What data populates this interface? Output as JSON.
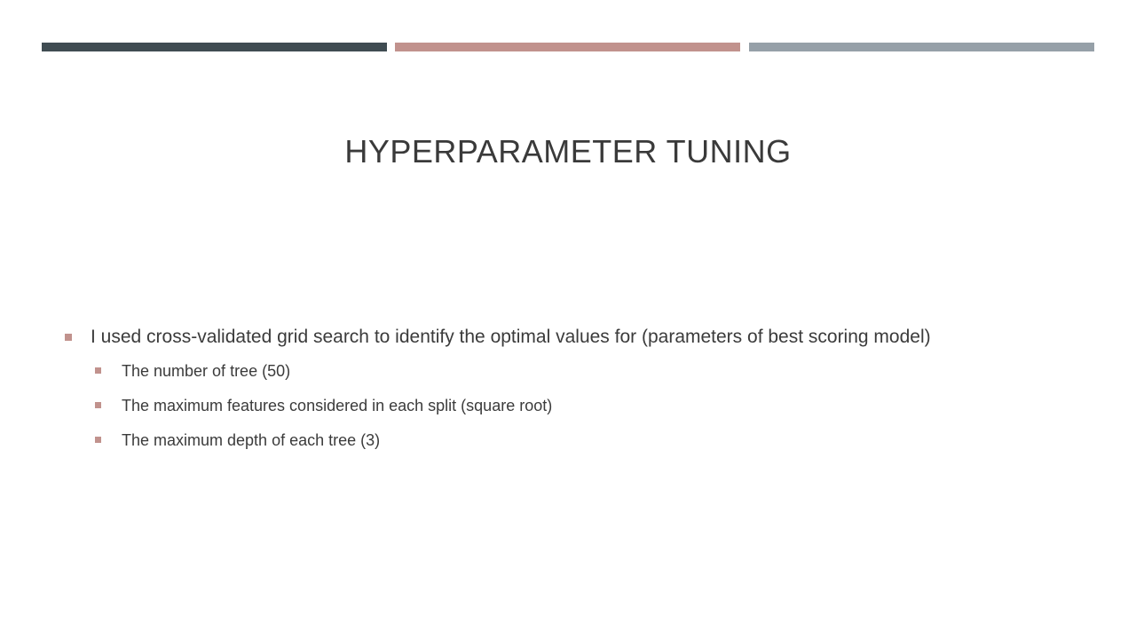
{
  "slide": {
    "accent_colors": [
      "#404c52",
      "#c1928d",
      "#96a0a8"
    ],
    "title": "HYPERPARAMETER TUNING",
    "bullets": {
      "main": "I used cross-validated grid search to identify the optimal values for (parameters of best scoring model)",
      "sub": [
        "The number of tree (50)",
        "The maximum features considered in each split (square root)",
        "The maximum depth of each tree (3)"
      ]
    },
    "bullet_icon": "square-bullet-icon"
  }
}
